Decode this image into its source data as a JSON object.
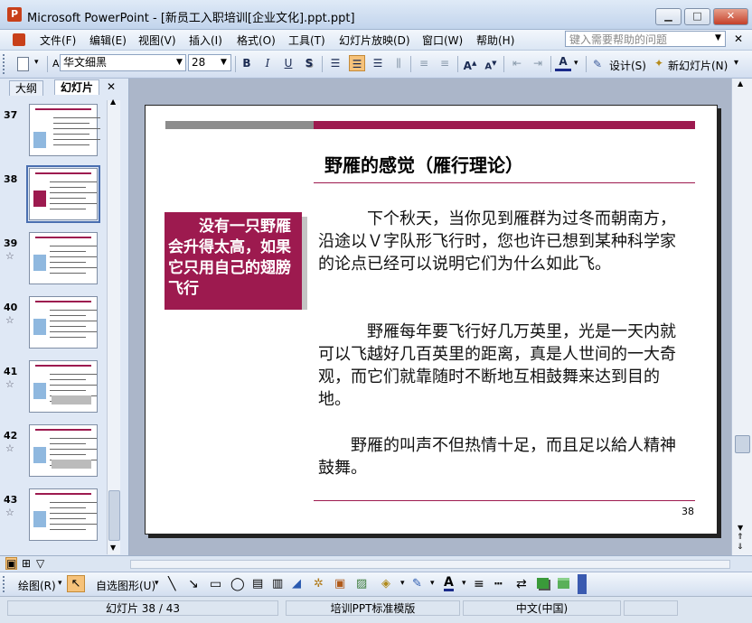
{
  "window": {
    "app_icon": "P",
    "title": "Microsoft PowerPoint - [新员工入职培训[企业文化].ppt.ppt]",
    "minimize": "▁",
    "maximize": "□",
    "close": "✕"
  },
  "menu": {
    "items": [
      "文件(F)",
      "编辑(E)",
      "视图(V)",
      "插入(I)",
      "格式(O)",
      "工具(T)",
      "幻灯片放映(D)",
      "窗口(W)",
      "帮助(H)"
    ],
    "help_placeholder": "键入需要帮助的问题"
  },
  "toolbar": {
    "font_name": "华文细黑",
    "font_size": "28",
    "bold": "B",
    "italic": "I",
    "underline": "U",
    "shadow": "S",
    "design_label": "设计(S)",
    "new_slide_label": "新幻灯片(N)"
  },
  "left_pane": {
    "tabs": [
      "大纲",
      "幻灯片"
    ],
    "close": "✕",
    "thumbnails": [
      {
        "num": "37",
        "star": false
      },
      {
        "num": "38",
        "star": false,
        "selected": true
      },
      {
        "num": "39",
        "star": true
      },
      {
        "num": "40",
        "star": true
      },
      {
        "num": "41",
        "star": true
      },
      {
        "num": "42",
        "star": true
      },
      {
        "num": "43",
        "star": true
      }
    ]
  },
  "slide": {
    "title": "野雁的感觉（雁行理论）",
    "callout": "　　没有一只野雁会升得太高，如果它只用自己的翅膀飞行",
    "para1": "　　　下个秋天，当你见到雁群为过冬而朝南方，沿途以Ｖ字队形飞行时，您也许已想到某种科学家的论点已经可以说明它们为什么如此飞。",
    "para2": "　　　野雁每年要飞行好几万英里，光是一天内就可以飞越好几百英里的距离，真是人世间的一大奇观，而它们就靠随时不断地互相鼓舞来达到目的地。",
    "para3": "　　野雁的叫声不但热情十足，而且足以給人精神鼓舞。",
    "page_number": "38",
    "colors": {
      "accent": "#9d1a4f",
      "gray_bar": "#8c8c8c"
    }
  },
  "drawbar": {
    "draw_label": "绘图(R)",
    "autoshape_label": "自选图形(U)"
  },
  "status": {
    "slide_position": "幻灯片 38 / 43",
    "template": "培训PPT标准模版",
    "language": "中文(中国)"
  }
}
